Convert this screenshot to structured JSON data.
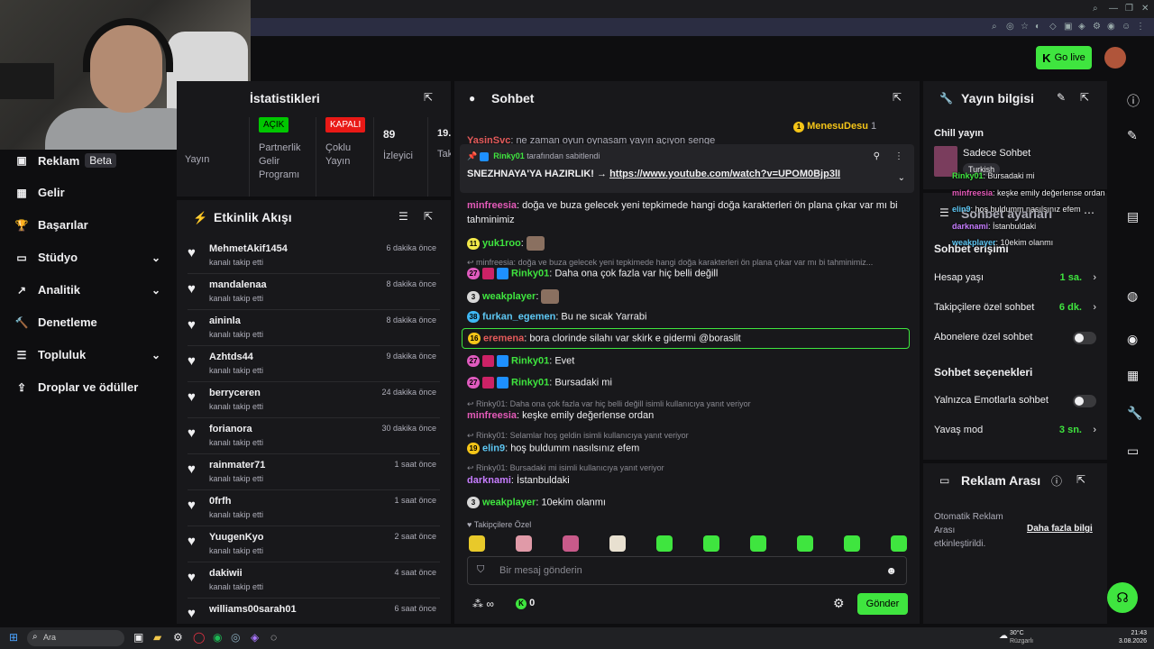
{
  "header": {
    "go_live": "Go live"
  },
  "nav": {
    "items": [
      {
        "label": "Reklam",
        "badge": "Beta"
      },
      {
        "label": "Gelir"
      },
      {
        "label": "Başarılar"
      },
      {
        "label": "Stüdyo"
      },
      {
        "label": "Analitik"
      },
      {
        "label": "Denetleme"
      },
      {
        "label": "Topluluk"
      },
      {
        "label": "Droplar ve ödüller"
      }
    ]
  },
  "stats": {
    "title": "İstatistikleri",
    "yayin": "Yayın",
    "partner_badge": "AÇIK",
    "partner_label1": "Partnerlik",
    "partner_label2": "Gelir",
    "partner_label3": "Programı",
    "multi_badge": "KAPALI",
    "multi_label1": "Çoklu",
    "multi_label2": "Yayın",
    "viewers": "89",
    "viewers_label": "İzleyici",
    "followers_partial": "19.",
    "followers_label": "Tak"
  },
  "activity": {
    "title": "Etkinlik Akışı",
    "items": [
      {
        "name": "MehmetAkif1454",
        "sub": "kanalı takip etti",
        "time": "6 dakika önce"
      },
      {
        "name": "mandalenaa",
        "sub": "kanalı takip etti",
        "time": "8 dakika önce"
      },
      {
        "name": "aininla",
        "sub": "kanalı takip etti",
        "time": "8 dakika önce"
      },
      {
        "name": "Azhtds44",
        "sub": "kanalı takip etti",
        "time": "9 dakika önce"
      },
      {
        "name": "berryceren",
        "sub": "kanalı takip etti",
        "time": "24 dakika önce"
      },
      {
        "name": "forianora",
        "sub": "kanalı takip etti",
        "time": "30 dakika önce"
      },
      {
        "name": "rainmater71",
        "sub": "kanalı takip etti",
        "time": "1 saat önce"
      },
      {
        "name": "0frfh",
        "sub": "kanalı takip etti",
        "time": "1 saat önce"
      },
      {
        "name": "YuugenKyo",
        "sub": "kanalı takip etti",
        "time": "2 saat önce"
      },
      {
        "name": "dakiwii",
        "sub": "kanalı takip etti",
        "time": "4 saat önce"
      },
      {
        "name": "williams00sarah01",
        "sub": "",
        "time": "6 saat önce"
      }
    ]
  },
  "chat": {
    "title": "Sohbet",
    "top_gifter": "MenesuDesu",
    "top_gifter_count": "1",
    "cut_line_user": "YasinSvc",
    "cut_line_text": ": ne zaman oyun oynasam yayın açıyon senge",
    "pinned_by_user": "Rinky01",
    "pinned_by_text": "tarafından sabitlendi",
    "pinned_text": "SNEZHNAYA'YA HAZIRLIK! →",
    "pinned_link": "https://www.youtube.com/watch?v=UPOM0Bjp3lI",
    "messages": [
      {
        "user": "minfreesia",
        "text": ": doğa ve buza gelecek yeni tepkimede hangi doğa karakterleri ön plana çıkar var mı bi"
      },
      {
        "user": "",
        "text": "tahminimiz"
      },
      {
        "level": "11",
        "user": "yuk1roo",
        "text": ":"
      },
      {
        "reply": "minfreesia: doğa ve buza gelecek yeni tepkimede hangi doğa karakterleri ön plana çıkar var mı bi tahminimiz..."
      },
      {
        "level": "27",
        "user": "Rinky01",
        "text": ": Daha ona çok fazla var hiç belli değill"
      },
      {
        "level": "3",
        "user": "weakplayer",
        "text": ":"
      },
      {
        "level": "38",
        "user": "furkan_egemen",
        "text": ": Bu ne sıcak Yarrabi"
      },
      {
        "level": "16",
        "user": "eremena",
        "text": ": bora clorinde silahı var skirk e gidermi @boraslit"
      },
      {
        "level": "27",
        "user": "Rinky01",
        "text": ": Evet"
      },
      {
        "level": "27",
        "user": "Rinky01",
        "text": ": Bursadaki mi"
      },
      {
        "reply": "Rinky01: Daha ona çok fazla var hiç belli değill isimli kullanıcıya yanıt veriyor"
      },
      {
        "user": "minfreesia",
        "text": ": keşke emily değerlense ordan"
      },
      {
        "reply": "Rinky01: Selamlar hoş geldin     isimli kullanıcıya yanıt veriyor"
      },
      {
        "level": "19",
        "user": "elin9",
        "text": ": hoş buldumm     nasılsınız efem"
      },
      {
        "reply": "Rinky01: Bursadaki mi isimli kullanıcıya yanıt veriyor"
      },
      {
        "user": "darknami",
        "text": ": İstanbuldaki"
      },
      {
        "level": "3",
        "user": "weakplayer",
        "text": ": 10ekim olanmı"
      }
    ],
    "followers_only": "Takipçilere Özel",
    "input_placeholder": "Bir mesaj gönderin",
    "points": "0",
    "send": "Gönder"
  },
  "stream_info": {
    "title": "Yayın bilgisi",
    "category": "Chill yayın",
    "game": "Sadece Sohbet",
    "tag": "Turkish"
  },
  "chat_settings": {
    "title": "Sohbet ayarları",
    "section1": "Sohbet erişimi",
    "account_age": "Hesap yaşı",
    "account_age_val": "1 sa.",
    "followers_chat": "Takipçilere özel sohbet",
    "followers_chat_val": "6 dk.",
    "subs_chat": "Abonelere özel sohbet",
    "section2": "Sohbet seçenekleri",
    "emote_only": "Yalnızca Emotlarla sohbet",
    "slow_mode": "Yavaş mod",
    "slow_mode_val": "3 sn."
  },
  "ad_break": {
    "title": "Reklam Arası",
    "text1": "Otomatik Reklam",
    "text2": "Arası",
    "text3": "etkinleştirildi.",
    "link": "Daha fazla bilgi"
  },
  "overlay": {
    "lines": [
      {
        "user": "Rinky01",
        "text": ": Bursadaki mi"
      },
      {
        "user": "minfreesia",
        "text": ": keşke emily değerlense ordan"
      },
      {
        "user": "elin9",
        "text": ": hoş buldumm     nasılsınız efem"
      },
      {
        "user": "darknami",
        "text": ": İstanbuldaki"
      },
      {
        "user": "weakplayer",
        "text": ": 10ekim olanmı"
      }
    ]
  },
  "taskbar": {
    "search": "Ara",
    "temp": "30°C",
    "weather": "Rüzgarlı",
    "time": "21:43",
    "date": "3.08.2026"
  },
  "colors": {
    "accent": "#3fe53f",
    "bg": "#0e0e10",
    "panel": "#18181b"
  }
}
